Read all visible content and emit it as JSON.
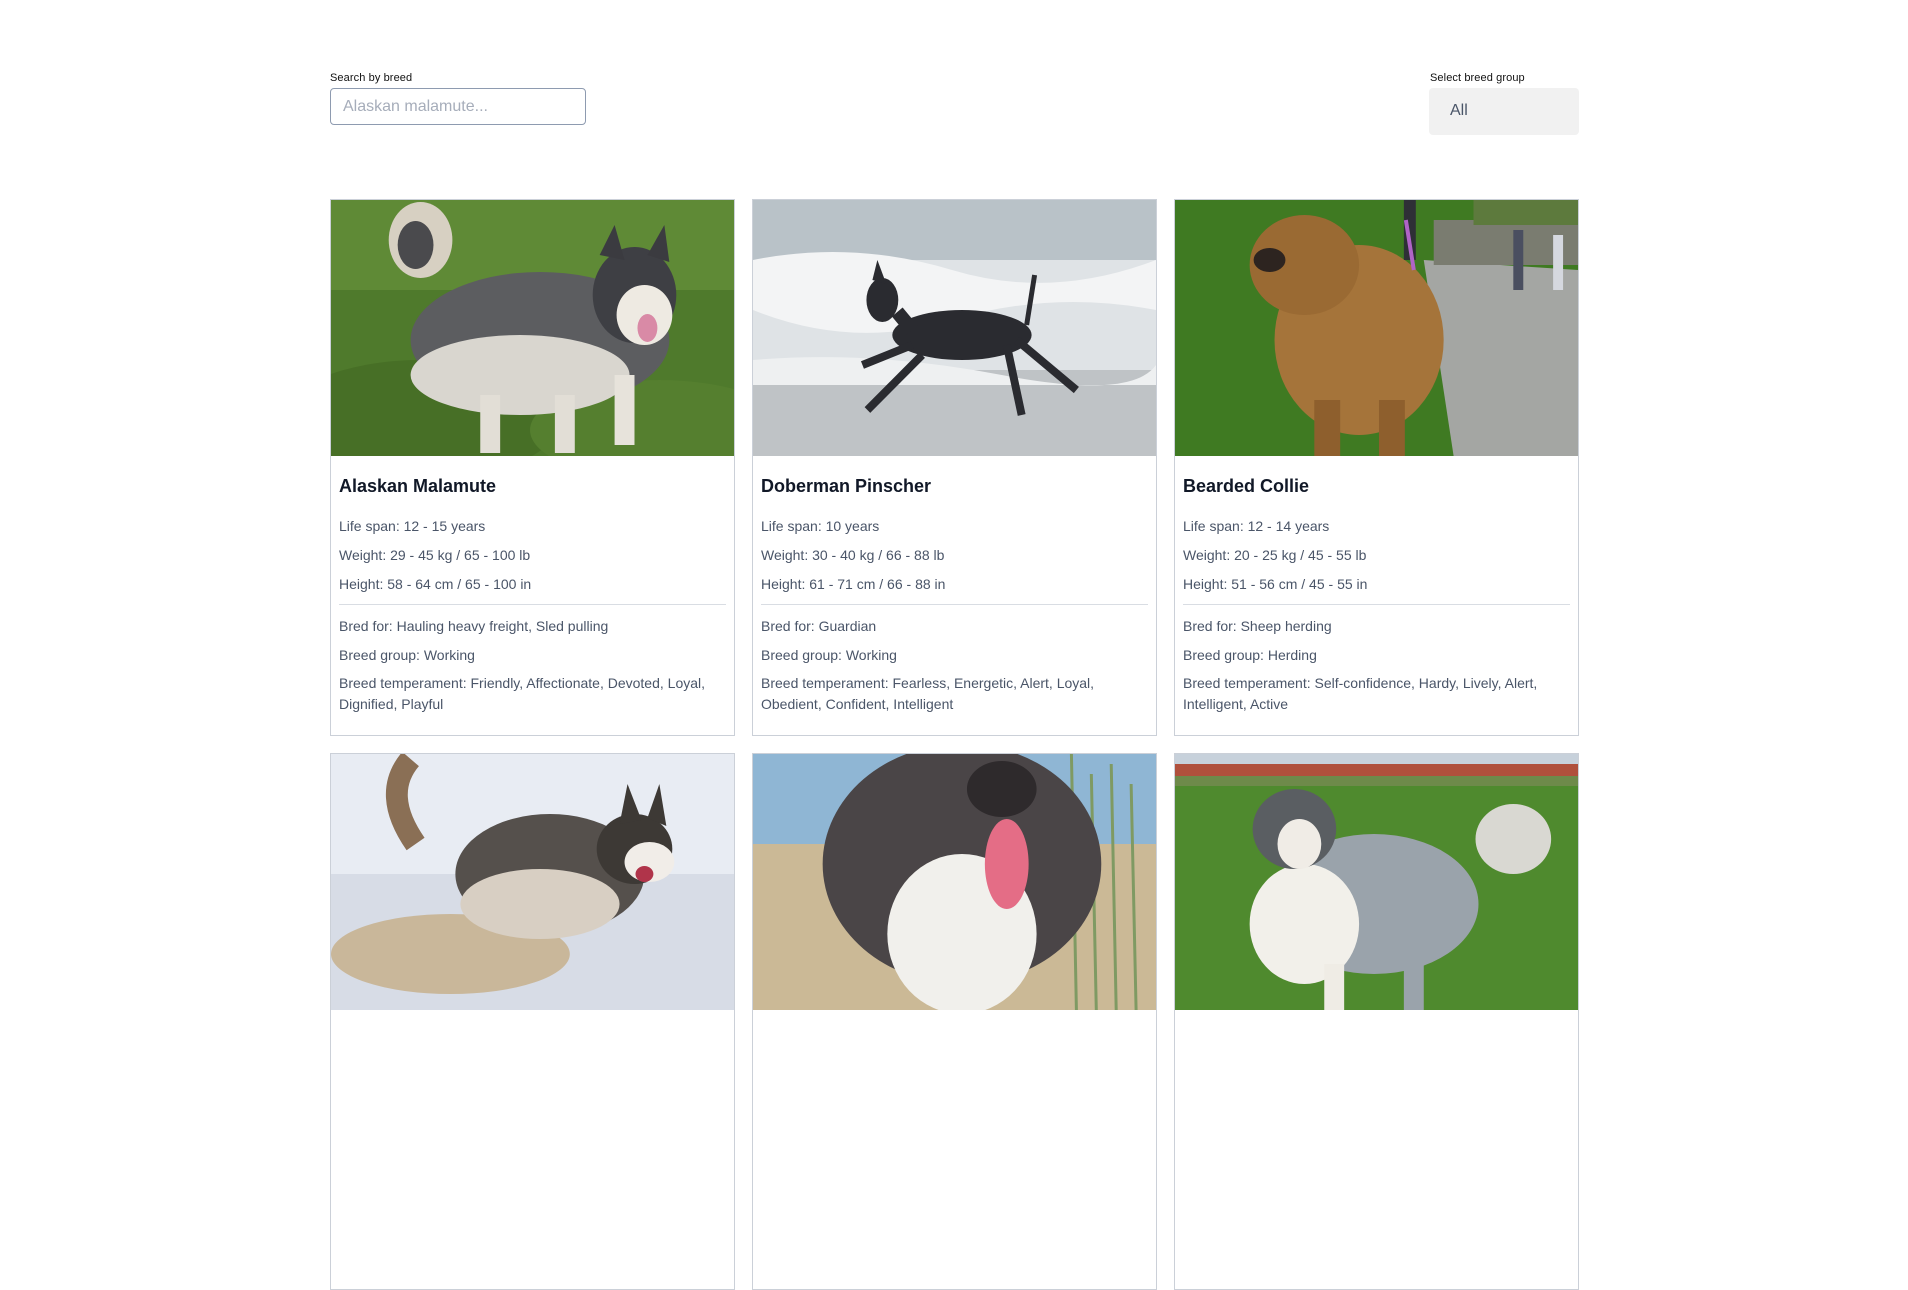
{
  "search": {
    "label": "Search by breed",
    "placeholder": "Alaskan malamute...",
    "value": ""
  },
  "group_filter": {
    "label": "Select breed group",
    "selected": "All"
  },
  "cards": [
    {
      "name": "Alaskan Malamute",
      "life_span": "Life span: 12 - 15 years",
      "weight": "Weight: 29 - 45 kg / 65 - 100 lb",
      "height": "Height: 58 - 64 cm / 65 - 100 in",
      "bred_for": "Bred for: Hauling heavy freight, Sled pulling",
      "breed_group": "Breed group: Working",
      "temperament": "Breed temperament: Friendly, Affectionate, Devoted, Loyal, Dignified, Playful"
    },
    {
      "name": "Doberman Pinscher",
      "life_span": "Life span: 10 years",
      "weight": "Weight: 30 - 40 kg / 66 - 88 lb",
      "height": "Height: 61 - 71 cm / 66 - 88 in",
      "bred_for": "Bred for: Guardian",
      "breed_group": "Breed group: Working",
      "temperament": "Breed temperament: Fearless, Energetic, Alert, Loyal, Obedient, Confident, Intelligent"
    },
    {
      "name": "Bearded Collie",
      "life_span": "Life span: 12 - 14 years",
      "weight": "Weight: 20 - 25 kg / 45 - 55 lb",
      "height": "Height: 51 - 56 cm / 45 - 55 in",
      "bred_for": "Bred for: Sheep herding",
      "breed_group": "Breed group: Herding",
      "temperament": "Breed temperament: Self-confidence, Hardy, Lively, Alert, Intelligent, Active"
    },
    {
      "name": "",
      "life_span": "",
      "weight": "",
      "height": "",
      "bred_for": "",
      "breed_group": "",
      "temperament": ""
    },
    {
      "name": "",
      "life_span": "",
      "weight": "",
      "height": "",
      "bred_for": "",
      "breed_group": "",
      "temperament": ""
    },
    {
      "name": "",
      "life_span": "",
      "weight": "",
      "height": "",
      "bred_for": "",
      "breed_group": "",
      "temperament": ""
    }
  ]
}
